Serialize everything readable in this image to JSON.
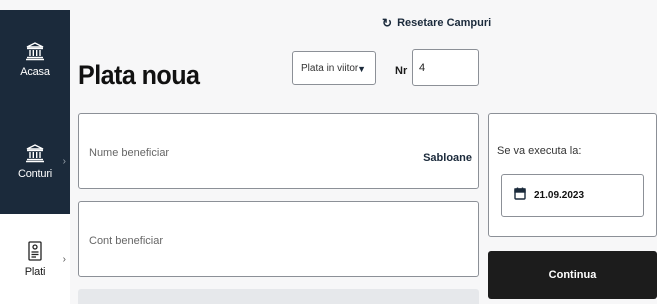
{
  "sidebar": {
    "items": [
      {
        "label": "Acasa",
        "icon": "bank-icon"
      },
      {
        "label": "Conturi",
        "icon": "bank-icon"
      },
      {
        "label": "Plati",
        "icon": "payment-document-icon"
      }
    ]
  },
  "header": {
    "reset_label": "Resetare Campuri",
    "title": "Plata noua"
  },
  "payment_type": {
    "selected": "Plata in viitor"
  },
  "number": {
    "label": "Nr",
    "value": "4"
  },
  "form": {
    "beneficiary_name_placeholder": "Nume beneficiar",
    "templates_label": "Sabloane",
    "beneficiary_account_placeholder": "Cont beneficiar"
  },
  "execution": {
    "label": "Se va executa la:",
    "date": "21.09.2023"
  },
  "continue_label": "Continua",
  "colors": {
    "sidebar_dark": "#1b2a3b",
    "button_dark": "#1c1c1c",
    "border": "#8c9097"
  }
}
